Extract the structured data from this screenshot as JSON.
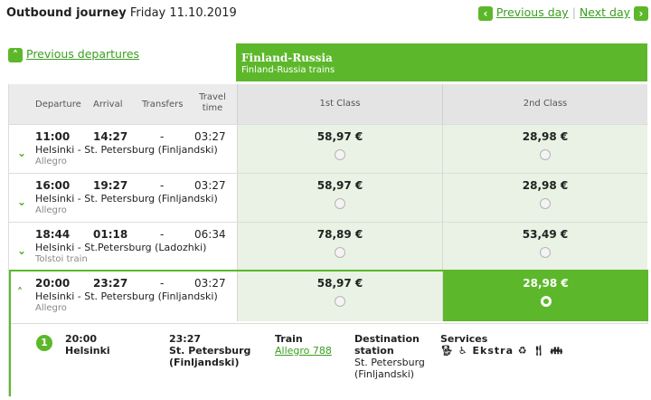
{
  "header": {
    "title": "Outbound journey",
    "date": "Friday 11.10.2019",
    "prev_day": "Previous day",
    "next_day": "Next day",
    "prev_departures": "Previous departures"
  },
  "banner": {
    "title": "Finland-Russia",
    "subtitle": "Finland-Russia trains"
  },
  "columns": {
    "departure": "Departure",
    "arrival": "Arrival",
    "transfers": "Transfers",
    "travel_time": "Travel time",
    "first_class": "1st Class",
    "second_class": "2nd Class"
  },
  "rows": [
    {
      "dep": "11:00",
      "arr": "14:27",
      "transfers": "-",
      "duration": "03:27",
      "route": "Helsinki - St. Petersburg (Finljandski)",
      "train": "Allegro",
      "price_1st": "58,97 €",
      "price_2nd": "28,98 €"
    },
    {
      "dep": "16:00",
      "arr": "19:27",
      "transfers": "-",
      "duration": "03:27",
      "route": "Helsinki - St. Petersburg (Finljandski)",
      "train": "Allegro",
      "price_1st": "58,97 €",
      "price_2nd": "28,98 €"
    },
    {
      "dep": "18:44",
      "arr": "01:18",
      "transfers": "-",
      "duration": "06:34",
      "route": "Helsinki - St.Petersburg (Ladozhki)",
      "train": "Tolstoi train",
      "price_1st": "78,89 €",
      "price_2nd": "53,49 €"
    },
    {
      "dep": "20:00",
      "arr": "23:27",
      "transfers": "-",
      "duration": "03:27",
      "route": "Helsinki - St. Petersburg (Finljandski)",
      "train": "Allegro",
      "price_1st": "58,97 €",
      "price_2nd": "28,98 €"
    }
  ],
  "detail": {
    "leg_number": "1",
    "dep_time": "20:00",
    "dep_station": "Helsinki",
    "arr_time": "23:27",
    "arr_station": "St. Petersburg (Finljandski)",
    "train_label": "Train",
    "train_link": "Allegro 788",
    "dest_label": "Destination station",
    "dest_value": "St. Petersburg (Finljandski)",
    "services_label": "Services",
    "services_text": "Ekstra",
    "services_icons": [
      "pet-icon",
      "wheelchair-icon",
      "ekstra-icon",
      "eco-icon",
      "restaurant-icon",
      "family-icon"
    ]
  },
  "colors": {
    "accent": "#5cb82a",
    "row_bg": "#e9f2e4",
    "header_bg": "#ebebeb"
  }
}
